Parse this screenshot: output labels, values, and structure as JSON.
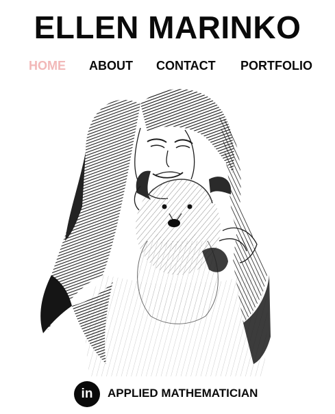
{
  "header": {
    "title": "ELLEN MARINKO"
  },
  "nav": {
    "items": [
      {
        "label": "HOME",
        "active": true
      },
      {
        "label": "ABOUT",
        "active": false
      },
      {
        "label": "CONTACT",
        "active": false
      },
      {
        "label": "PORTFOLIO",
        "active": false
      }
    ],
    "active_color": "#f2b8b8",
    "text_color": "#0a0a0a"
  },
  "hero": {
    "image": "pencil-sketch-woman-holding-dog"
  },
  "footer": {
    "linkedin_icon_glyph": "in",
    "linkedin_icon": "linkedin-icon",
    "tagline": "APPLIED MATHEMATICIAN"
  }
}
